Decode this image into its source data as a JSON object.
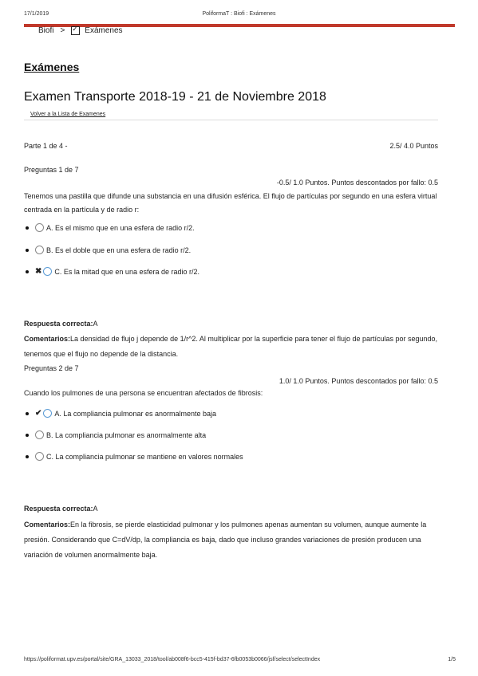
{
  "print_header": {
    "date": "17/1/2019",
    "title": "PoliformaT : Biofi : Exámenes"
  },
  "breadcrumb": {
    "root": "Biofi",
    "separator": ">",
    "current": "Exámenes"
  },
  "section_title": "Exámenes",
  "exam_title": "Examen Transporte 2018-19 - 21 de Noviembre 2018",
  "back_link": "Volver a la Lista de Examenes",
  "part": {
    "label": "Parte 1 de 4 -",
    "score": "2.5/ 4.0 Puntos"
  },
  "questions": [
    {
      "label": "Preguntas 1 de 7",
      "score": "-0.5/ 1.0 Puntos. Puntos descontados por fallo: 0.5",
      "text": "Tenemos una pastilla que difunde una substancia en una difusión esférica. El flujo de partículas por segundo en una esfera virtual centrada en la partícula y de radio r:",
      "options": [
        {
          "text": "A. Es el mismo que en una esfera de radio r/2.",
          "mark": ""
        },
        {
          "text": "B. Es el doble que en una esfera de radio r/2.",
          "mark": ""
        },
        {
          "text": "C. Es la mitad que en una esfera de radio r/2.",
          "mark": "✖"
        }
      ],
      "answer_label": "Respuesta correcta:",
      "answer_value": "A",
      "comment_label": "Comentarios:",
      "comment_text": "La densidad de flujo j depende de 1/r^2. Al multiplicar por la superficie para tener el flujo de partículas por segundo, tenemos que el flujo no depende de la distancia."
    },
    {
      "label": "Preguntas 2 de 7",
      "score": "1.0/ 1.0 Puntos. Puntos descontados por fallo: 0.5",
      "text": "Cuando los pulmones de una persona se encuentran afectados de fibrosis:",
      "options": [
        {
          "text": "A. La compliancia pulmonar es anormalmente baja",
          "mark": "✔"
        },
        {
          "text": "B. La compliancia pulmonar es anormalmente alta",
          "mark": ""
        },
        {
          "text": "C. La compliancia pulmonar se mantiene en valores normales",
          "mark": ""
        }
      ],
      "answer_label": "Respuesta correcta:",
      "answer_value": "A",
      "comment_label": "Comentarios:",
      "comment_text": "En la fibrosis, se pierde elasticidad pulmonar y los pulmones apenas aumentan su volumen, aunque aumente la presión. Considerando que C=dV/dp, la compliancia es baja, dado que incluso grandes variaciones de presión producen una variación de volumen anormalmente baja."
    }
  ],
  "footer": {
    "url": "https://poliformat.upv.es/portal/site/GRA_13033_2018/tool/ab008f6-bcc5-415f-bd37-6fb0053b0066/jsf/select/selectIndex",
    "page": "1/5"
  },
  "colors": {
    "accent_bar": "#c0392b",
    "radio_selected": "#5b9bd5"
  }
}
